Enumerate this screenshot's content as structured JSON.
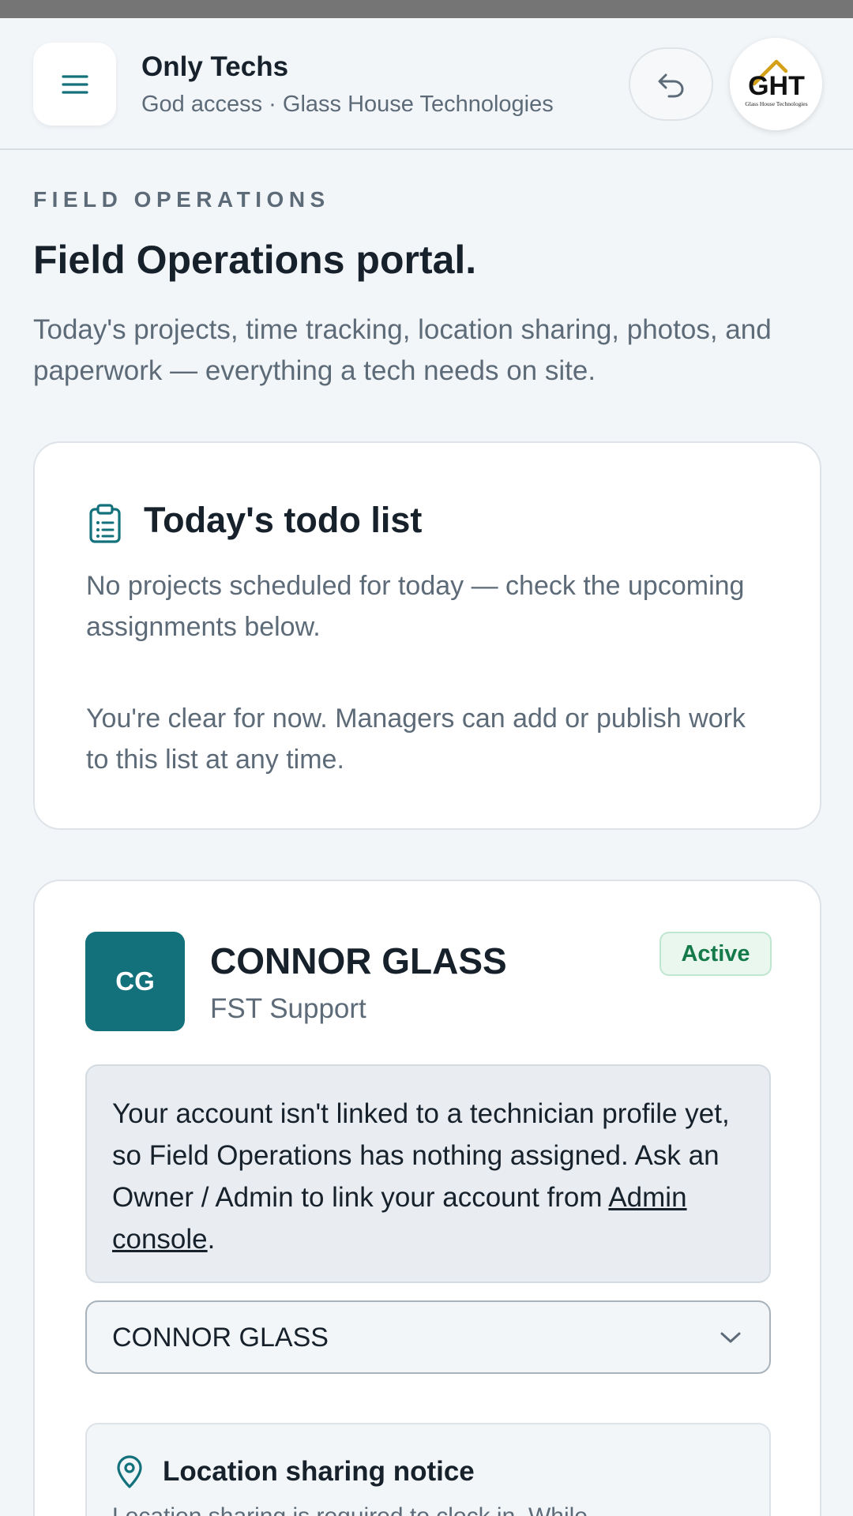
{
  "header": {
    "menu_icon": "menu-icon",
    "title": "Only Techs",
    "subtitle": "God access · Glass House Technologies",
    "back_icon": "undo-icon",
    "logo_text": "GHT",
    "logo_tagline": "Glass House Technologies"
  },
  "page": {
    "eyebrow": "FIELD OPERATIONS",
    "title": "Field Operations portal.",
    "description": "Today's projects, time tracking, location sharing, photos, and paperwork — everything a tech needs on site."
  },
  "todo": {
    "icon": "clipboard-icon",
    "title": "Today's todo list",
    "empty_message": "No projects scheduled for today — check the upcoming assignments below.",
    "hint": "You're clear for now. Managers can add or publish work to this list at any time."
  },
  "profile": {
    "initials": "CG",
    "name": "CONNOR GLASS",
    "role": "FST Support",
    "status": "Active",
    "notice_before_link": "Your account isn't linked to a technician profile yet, so Field Operations has nothing assigned. Ask an Owner / Admin to link your account from ",
    "notice_link": "Admin console",
    "notice_after_link": ".",
    "selected_technician": "CONNOR GLASS"
  },
  "location": {
    "icon": "map-pin-icon",
    "title": "Location sharing notice",
    "text": "Location sharing is required to clock in. While"
  },
  "colors": {
    "accent": "#13717b",
    "active_badge_bg": "#e9f7ef",
    "active_badge_text": "#147a4a",
    "background": "#f3f6f9"
  }
}
